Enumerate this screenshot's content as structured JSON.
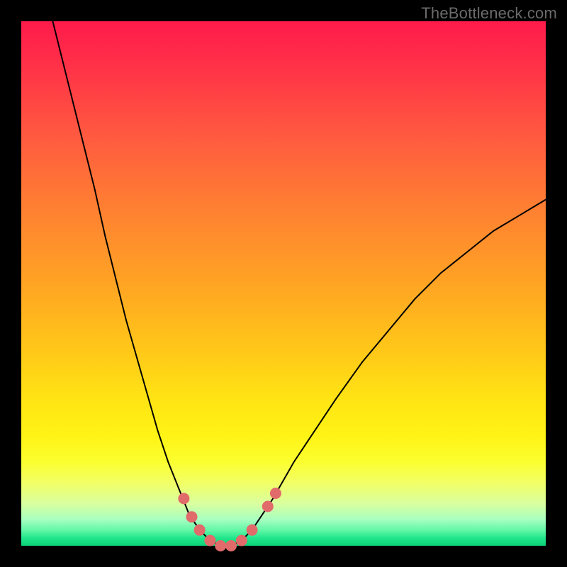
{
  "watermark": "TheBottleneck.com",
  "chart_data": {
    "type": "line",
    "title": "",
    "xlabel": "",
    "ylabel": "",
    "xlim": [
      0,
      100
    ],
    "ylim": [
      0,
      100
    ],
    "grid": false,
    "curve_points": [
      {
        "x": 6,
        "y": 100
      },
      {
        "x": 8,
        "y": 92
      },
      {
        "x": 10,
        "y": 84
      },
      {
        "x": 12,
        "y": 76
      },
      {
        "x": 14,
        "y": 68
      },
      {
        "x": 16,
        "y": 59
      },
      {
        "x": 18,
        "y": 51
      },
      {
        "x": 20,
        "y": 43
      },
      {
        "x": 22,
        "y": 36
      },
      {
        "x": 24,
        "y": 29
      },
      {
        "x": 26,
        "y": 22
      },
      {
        "x": 28,
        "y": 16
      },
      {
        "x": 30,
        "y": 11
      },
      {
        "x": 32,
        "y": 6
      },
      {
        "x": 34,
        "y": 3
      },
      {
        "x": 36,
        "y": 1
      },
      {
        "x": 38,
        "y": 0
      },
      {
        "x": 40,
        "y": 0
      },
      {
        "x": 42,
        "y": 1
      },
      {
        "x": 44,
        "y": 3
      },
      {
        "x": 46,
        "y": 6
      },
      {
        "x": 48,
        "y": 9
      },
      {
        "x": 52,
        "y": 16
      },
      {
        "x": 56,
        "y": 22
      },
      {
        "x": 60,
        "y": 28
      },
      {
        "x": 65,
        "y": 35
      },
      {
        "x": 70,
        "y": 41
      },
      {
        "x": 75,
        "y": 47
      },
      {
        "x": 80,
        "y": 52
      },
      {
        "x": 85,
        "y": 56
      },
      {
        "x": 90,
        "y": 60
      },
      {
        "x": 95,
        "y": 63
      },
      {
        "x": 100,
        "y": 66
      }
    ],
    "marker_points": [
      {
        "x": 31,
        "y": 9
      },
      {
        "x": 32.5,
        "y": 5.5
      },
      {
        "x": 34,
        "y": 3
      },
      {
        "x": 36,
        "y": 1
      },
      {
        "x": 38,
        "y": 0
      },
      {
        "x": 40,
        "y": 0
      },
      {
        "x": 42,
        "y": 1
      },
      {
        "x": 44,
        "y": 3
      },
      {
        "x": 47,
        "y": 7.5
      },
      {
        "x": 48.5,
        "y": 10
      }
    ],
    "marker_radius_px": 8,
    "colors": {
      "curve": "#000000",
      "marker": "#e16a6a",
      "gradient_top": "#ff1b4b",
      "gradient_bottom": "#0bd379"
    }
  }
}
